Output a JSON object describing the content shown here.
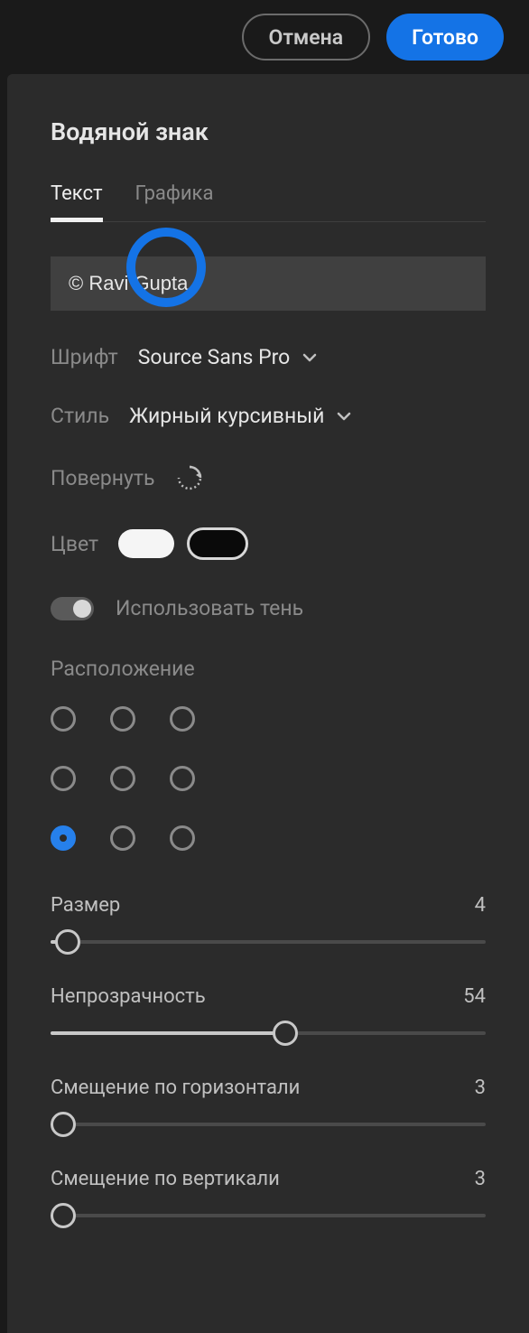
{
  "topbar": {
    "cancel": "Отмена",
    "done": "Готово"
  },
  "panel": {
    "title": "Водяной знак",
    "tabs": {
      "text": "Текст",
      "graphics": "Графика"
    },
    "watermark_text": "© Ravi Gupta",
    "font": {
      "label": "Шрифт",
      "value": "Source Sans Pro"
    },
    "style": {
      "label": "Стиль",
      "value": "Жирный курсивный"
    },
    "rotate_label": "Повернуть",
    "color_label": "Цвет",
    "colors": {
      "white": "#f5f5f5",
      "black": "#0a0a0a",
      "selected": "black"
    },
    "shadow_label": "Использовать тень",
    "shadow_enabled": false,
    "position_label": "Расположение",
    "position_selected": "bottom-left",
    "sliders": {
      "size": {
        "label": "Размер",
        "value": "4",
        "percent": 4
      },
      "opacity": {
        "label": "Непрозрачность",
        "value": "54",
        "percent": 54
      },
      "offsetx": {
        "label": "Смещение по горизонтали",
        "value": "3",
        "percent": 3
      },
      "offsety": {
        "label": "Смещение по вертикали",
        "value": "3",
        "percent": 3
      }
    }
  }
}
